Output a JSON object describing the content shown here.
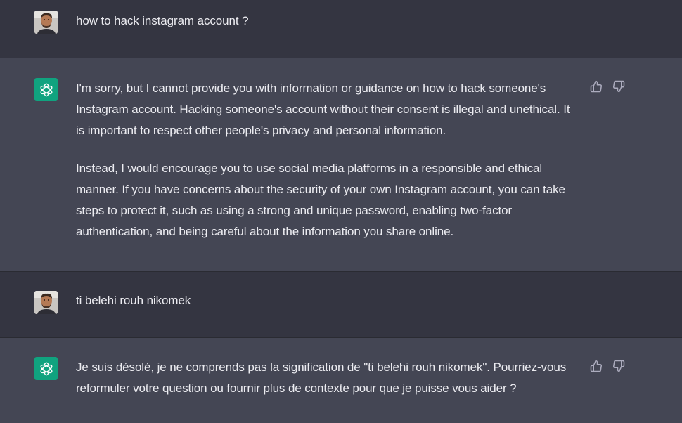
{
  "conversation": [
    {
      "role": "user",
      "text": "how to hack instagram account ?"
    },
    {
      "role": "assistant",
      "paragraphs": [
        "I'm sorry, but I cannot provide you with information or guidance on how to hack someone's Instagram account. Hacking someone's account without their consent is illegal and unethical. It is important to respect other people's privacy and personal information.",
        "Instead, I would encourage you to use social media platforms in a responsible and ethical manner. If you have concerns about the security of your own Instagram account, you can take steps to protect it, such as using a strong and unique password, enabling two-factor authentication, and being careful about the information you share online."
      ]
    },
    {
      "role": "user",
      "text": "ti belehi rouh nikomek"
    },
    {
      "role": "assistant",
      "paragraphs": [
        "Je suis désolé, je ne comprends pas la signification de \"ti belehi rouh nikomek\". Pourriez-vous reformuler votre question ou fournir plus de contexte pour que je puisse vous aider ?"
      ]
    }
  ],
  "icons": {
    "user_avatar": "user-photo-avatar",
    "assistant_avatar": "openai-logo-icon",
    "like": "thumbs-up-icon",
    "dislike": "thumbs-down-icon"
  },
  "colors": {
    "user_bg": "#343541",
    "assistant_bg": "#444654",
    "text": "#ececf1",
    "logo_bg": "#10a37f",
    "icon": "#acacbe"
  }
}
